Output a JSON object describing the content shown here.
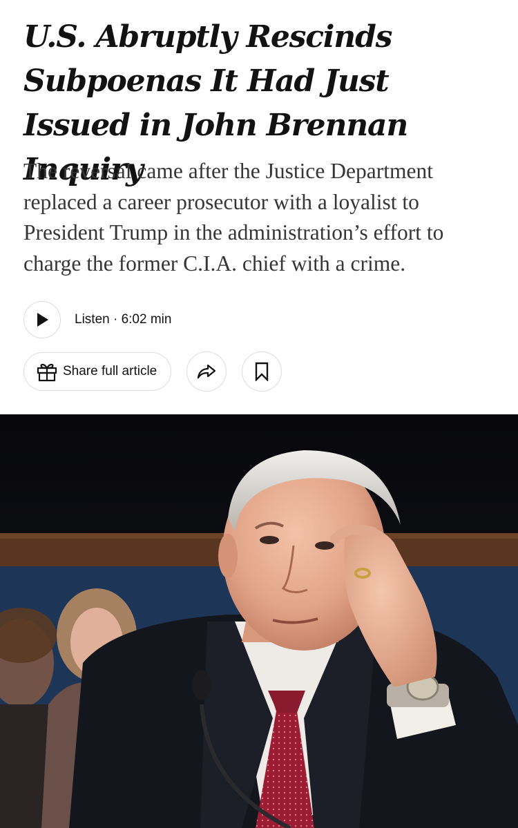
{
  "article": {
    "headline": "U.S. Abruptly Rescinds Subpoenas It Had Just Issued in John Brennan Inquiry",
    "summary": "The reversal came after the Justice Department replaced a career prosecutor with a loyalist to President Trump in the administration’s effort to charge the former C.I.A. chief with a crime."
  },
  "audio": {
    "listen_label": "Listen · 6:02 min",
    "play_icon": "play-icon"
  },
  "actions": {
    "share_label": "Share full article",
    "gift_icon": "gift-icon",
    "forward_icon": "share-arrow-icon",
    "save_icon": "bookmark-icon"
  },
  "colors": {
    "text": "#121212",
    "summary_text": "#363636",
    "border": "#dcdcdc",
    "tie": "#9c1c34"
  }
}
